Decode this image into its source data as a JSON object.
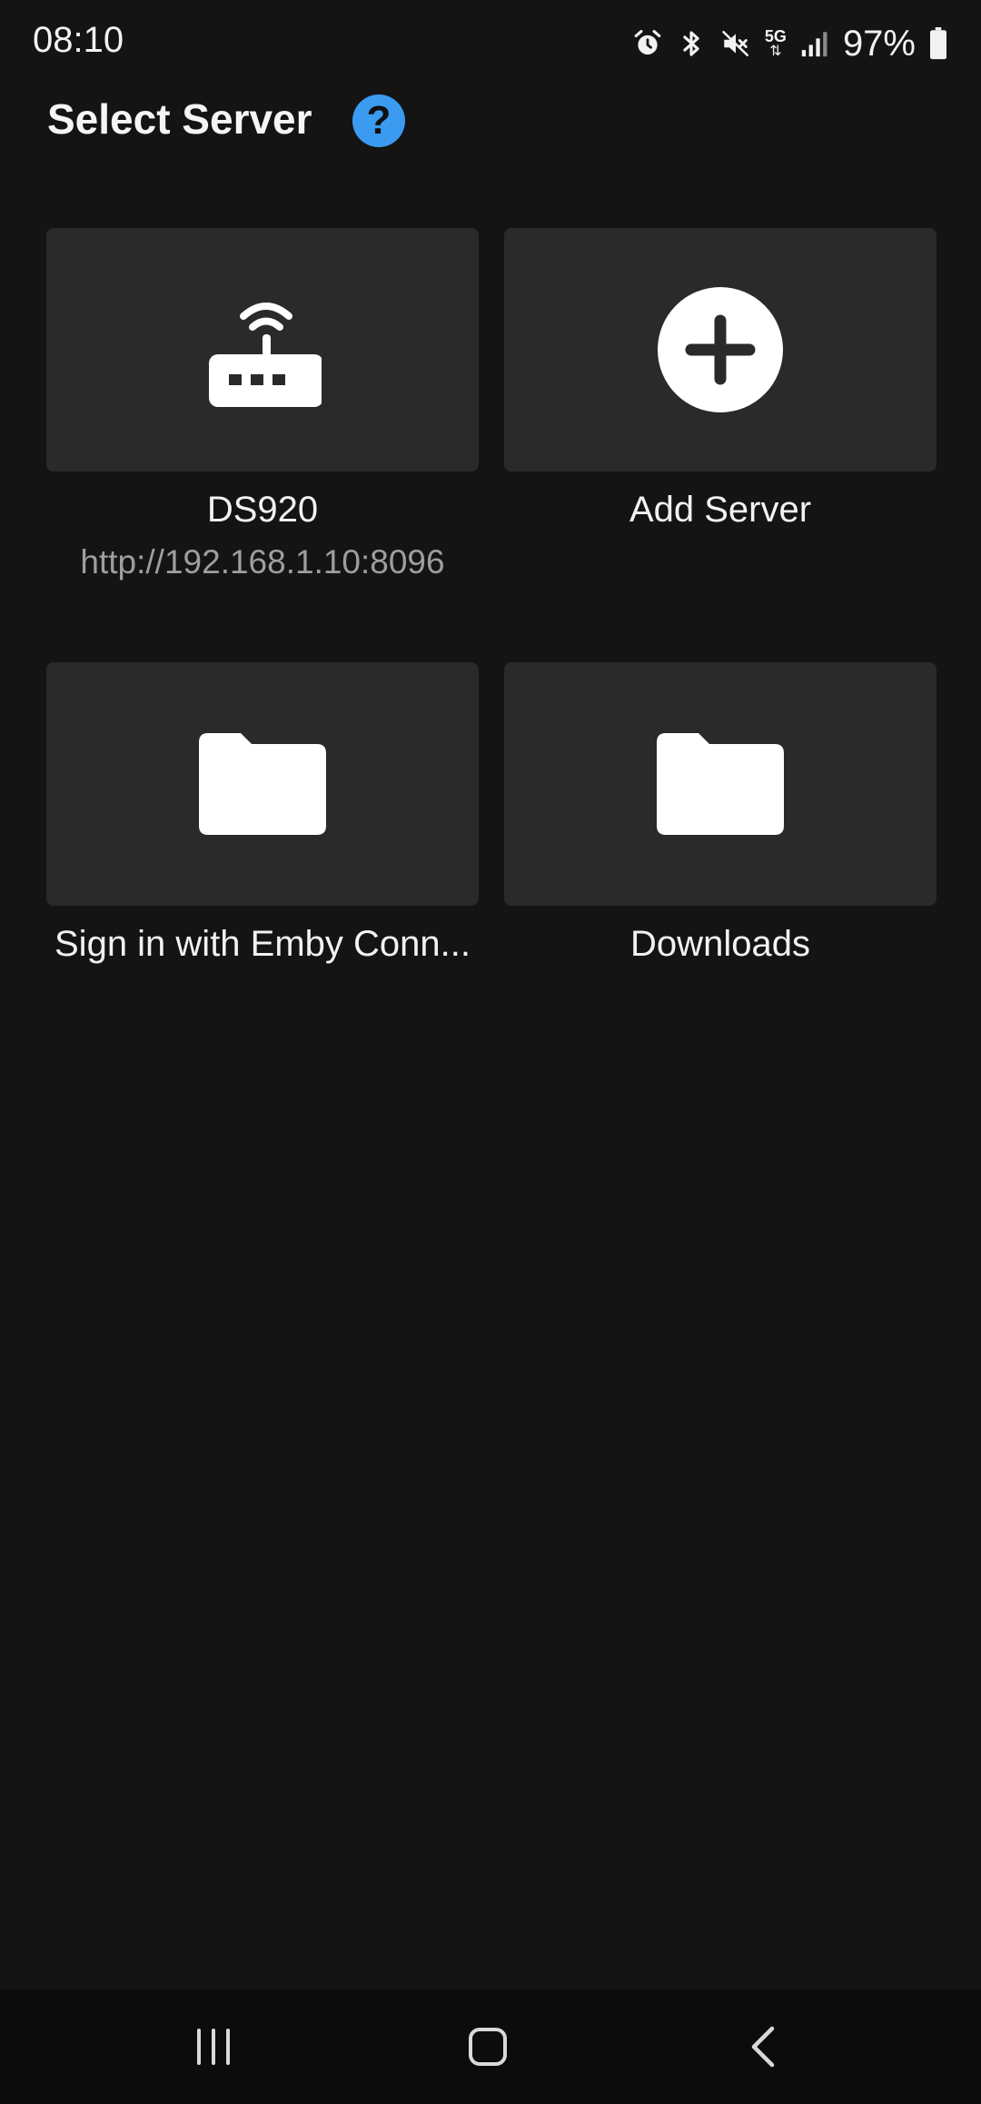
{
  "status_bar": {
    "time": "08:10",
    "network": "5G",
    "battery": "97%",
    "icons": [
      "alarm-icon",
      "bluetooth-icon",
      "mute-icon",
      "5g-icon",
      "signal-icon",
      "battery-icon"
    ]
  },
  "header": {
    "title": "Select Server",
    "help_label": "?"
  },
  "servers": [
    {
      "title": "DS920",
      "subtitle": "http://192.168.1.10:8096",
      "icon": "router-icon"
    },
    {
      "title": "Add Server",
      "subtitle": "",
      "icon": "plus-circle-icon"
    },
    {
      "title": "Sign in with Emby Conn...",
      "subtitle": "",
      "icon": "folder-icon"
    },
    {
      "title": "Downloads",
      "subtitle": "",
      "icon": "folder-icon"
    }
  ],
  "nav_bar": {
    "icons": [
      "recent-apps-icon",
      "home-icon",
      "back-icon"
    ]
  },
  "colors": {
    "background": "#141414",
    "tile": "#2a2a2a",
    "accent": "#3a9bf0",
    "subtitle": "#9e9e9e"
  }
}
